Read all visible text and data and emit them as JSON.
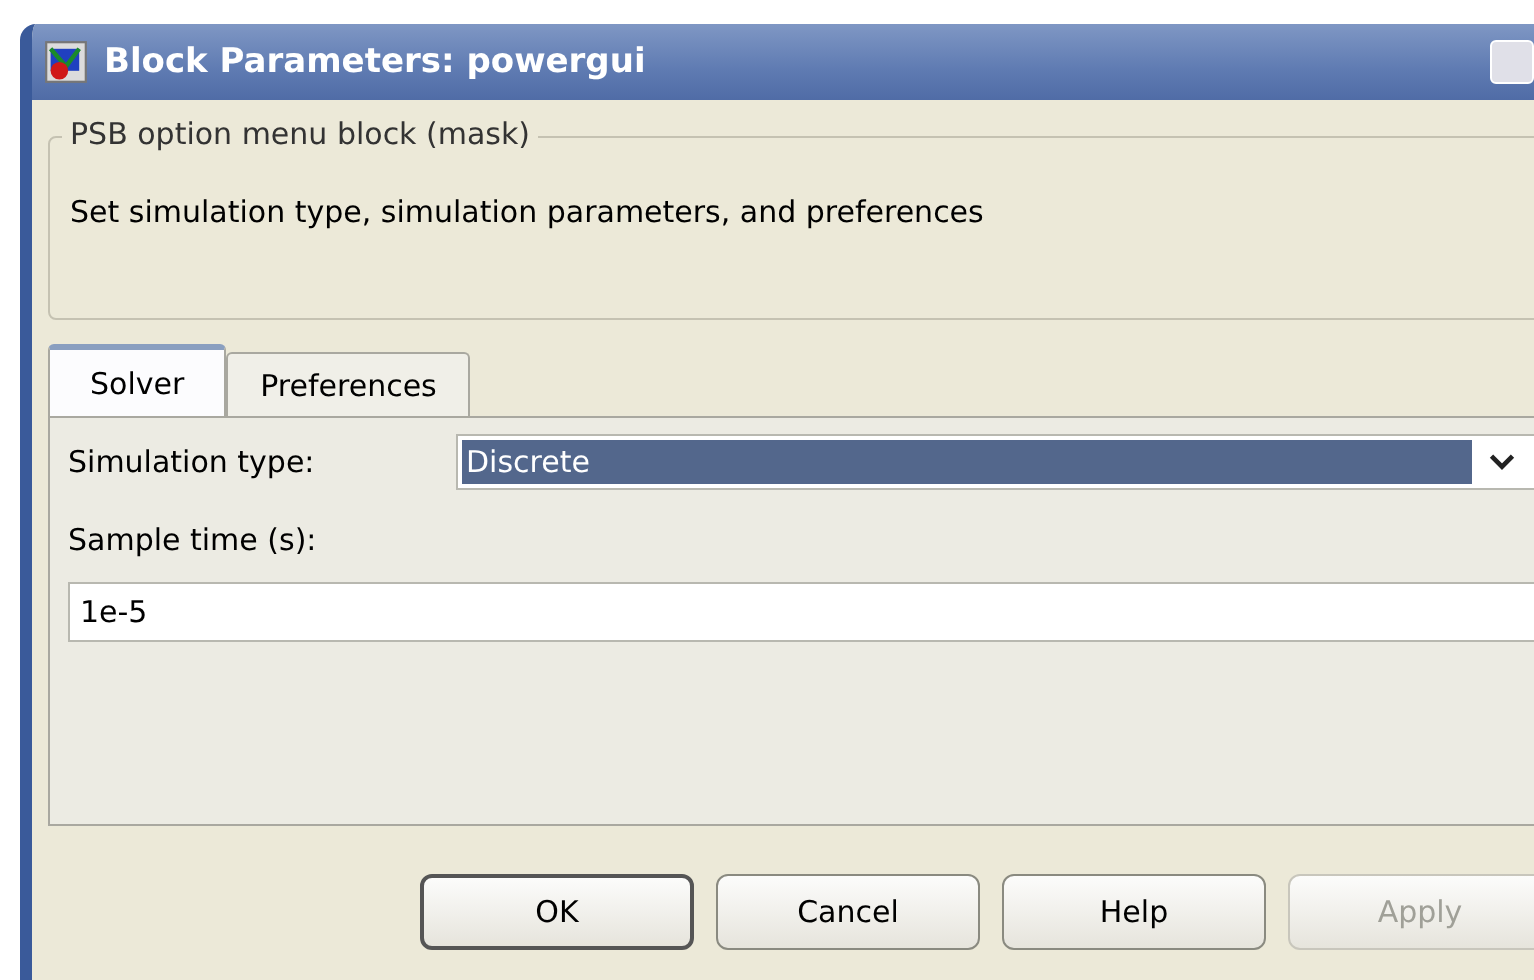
{
  "window": {
    "title": "Block Parameters: powergui"
  },
  "group": {
    "title": "PSB option menu block (mask)",
    "description": "Set simulation type, simulation parameters, and preferences"
  },
  "tabs": [
    {
      "label": "Solver",
      "selected": true
    },
    {
      "label": "Preferences",
      "selected": false
    }
  ],
  "fields": [
    {
      "kind": "dropdown",
      "label": "Simulation type:",
      "value": "Discrete"
    },
    {
      "kind": "text",
      "label": "Sample time (s):",
      "value": "1e-5"
    }
  ],
  "buttons": [
    {
      "label": "OK",
      "disabled": false,
      "default": true
    },
    {
      "label": "Cancel",
      "disabled": false,
      "default": false
    },
    {
      "label": "Help",
      "disabled": false,
      "default": false
    },
    {
      "label": "Apply",
      "disabled": true,
      "default": false
    }
  ]
}
